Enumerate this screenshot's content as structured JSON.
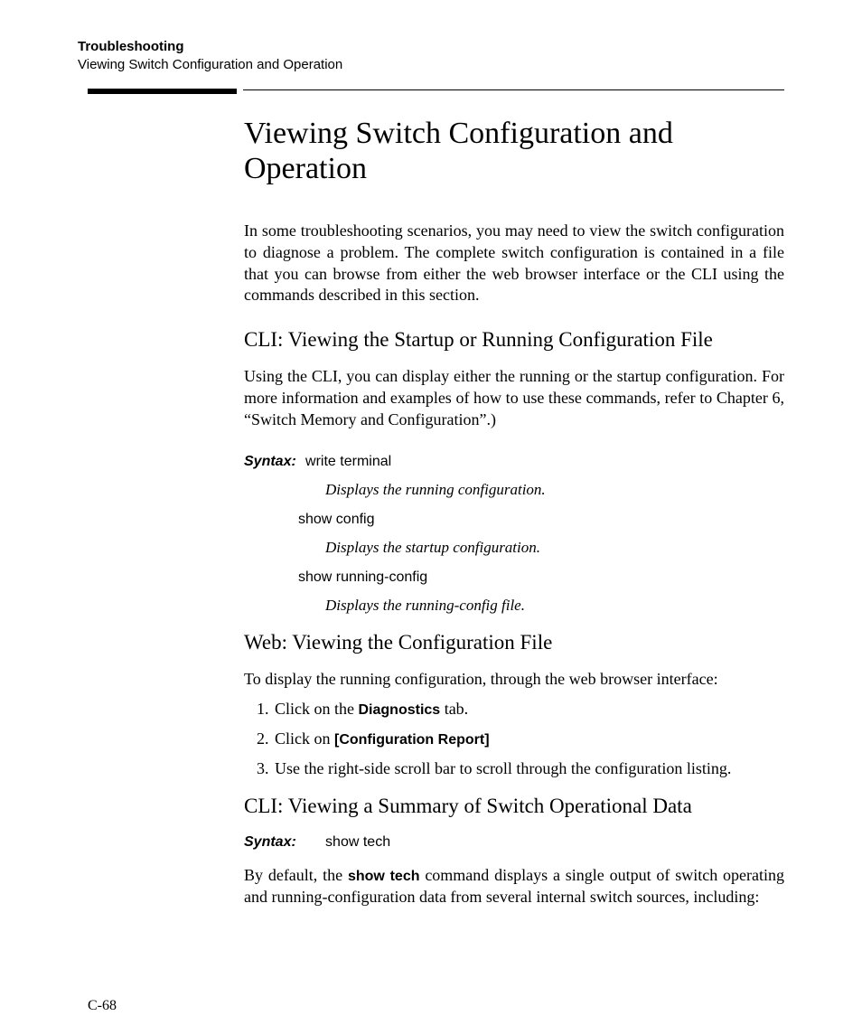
{
  "header": {
    "chapter": "Troubleshooting",
    "section": "Viewing Switch Configuration and Operation"
  },
  "title": "Viewing Switch Configuration and Operation",
  "intro": "In some troubleshooting scenarios, you may need to view the switch configuration to diagnose a problem. The complete switch configuration is contained in a file that you can browse from either the web browser interface or the CLI using the commands described in this section.",
  "cli_view_config": {
    "heading": "CLI: Viewing the Startup or Running Configuration File",
    "para": "Using the CLI, you can display either the running or the startup configuration. For more information and examples of how to use these commands, refer to Chapter 6, “Switch Memory and Configuration”.)",
    "syntax_label": "Syntax:",
    "cmd1": "write terminal",
    "expl1": "Displays the running configuration.",
    "cmd2": "show config",
    "expl2": "Displays the startup configuration.",
    "cmd3": "show running-config",
    "expl3": "Displays the running-config file."
  },
  "web_view": {
    "heading": "Web: Viewing the Configuration File",
    "para": "To display the running configuration, through the web browser interface:",
    "steps": {
      "s1_pre": "Click on the ",
      "s1_b": "Diagnostics",
      "s1_post": " tab.",
      "s2_pre": "Click on ",
      "s2_b": "[Configuration Report]",
      "s3": "Use the right-side scroll bar to scroll through the configuration listing."
    }
  },
  "cli_summary": {
    "heading": "CLI: Viewing a Summary of Switch Operational Data",
    "syntax_label": "Syntax:",
    "cmd": "show tech",
    "para_pre": "By default, the ",
    "para_b": "show tech",
    "para_post": " command displays a single output of switch operating and running-configuration data from several internal switch sources, including:"
  },
  "page_number": "C-68"
}
